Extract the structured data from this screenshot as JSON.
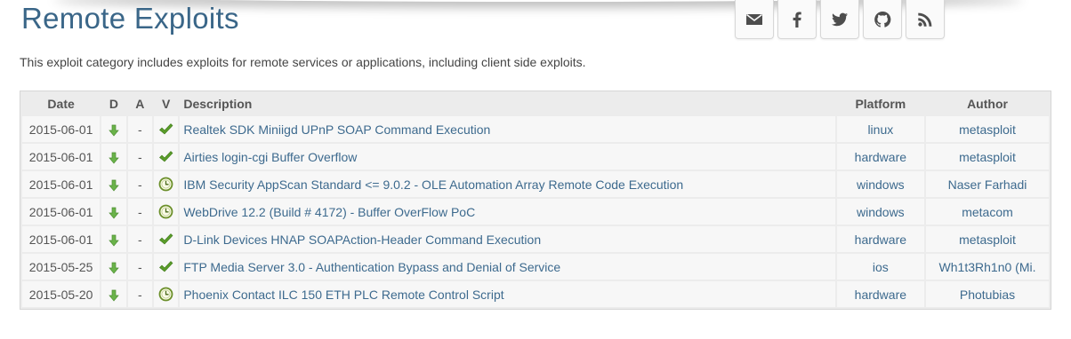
{
  "page": {
    "title": "Remote Exploits",
    "intro": "This exploit category includes exploits for remote services or applications, including client side exploits."
  },
  "social": [
    {
      "icon": "envelope-icon",
      "name": "email-button"
    },
    {
      "icon": "facebook-icon",
      "name": "facebook-button"
    },
    {
      "icon": "twitter-icon",
      "name": "twitter-button"
    },
    {
      "icon": "github-icon",
      "name": "github-button"
    },
    {
      "icon": "rss-icon",
      "name": "rss-button"
    }
  ],
  "table": {
    "headers": {
      "date": "Date",
      "download": "D",
      "app": "A",
      "verified": "V",
      "description": "Description",
      "platform": "Platform",
      "author": "Author"
    },
    "colors": {
      "download_arrow": "#6ab34a",
      "verified_check": "#5a9c2a",
      "pending_clock": "#6b8f2a"
    },
    "rows": [
      {
        "date": "2015-06-01",
        "app": "-",
        "verified": "check",
        "description": "Realtek SDK Miniigd UPnP SOAP Command Execution",
        "platform": "linux",
        "author": "metasploit"
      },
      {
        "date": "2015-06-01",
        "app": "-",
        "verified": "check",
        "description": "Airties login-cgi Buffer Overflow",
        "platform": "hardware",
        "author": "metasploit"
      },
      {
        "date": "2015-06-01",
        "app": "-",
        "verified": "clock",
        "description": "IBM Security AppScan Standard <= 9.0.2 - OLE Automation Array Remote Code Execution",
        "platform": "windows",
        "author": "Naser Farhadi"
      },
      {
        "date": "2015-06-01",
        "app": "-",
        "verified": "clock",
        "description": "WebDrive 12.2 (Build # 4172) - Buffer OverFlow PoC",
        "platform": "windows",
        "author": "metacom"
      },
      {
        "date": "2015-06-01",
        "app": "-",
        "verified": "check",
        "description": "D-Link Devices HNAP SOAPAction-Header Command Execution",
        "platform": "hardware",
        "author": "metasploit"
      },
      {
        "date": "2015-05-25",
        "app": "-",
        "verified": "check",
        "description": "FTP Media Server 3.0 - Authentication Bypass and Denial of Service",
        "platform": "ios",
        "author": "Wh1t3Rh1n0 (Mi."
      },
      {
        "date": "2015-05-20",
        "app": "-",
        "verified": "clock",
        "description": "Phoenix Contact ILC 150 ETH PLC Remote Control Script",
        "platform": "hardware",
        "author": "Photubias"
      }
    ]
  }
}
